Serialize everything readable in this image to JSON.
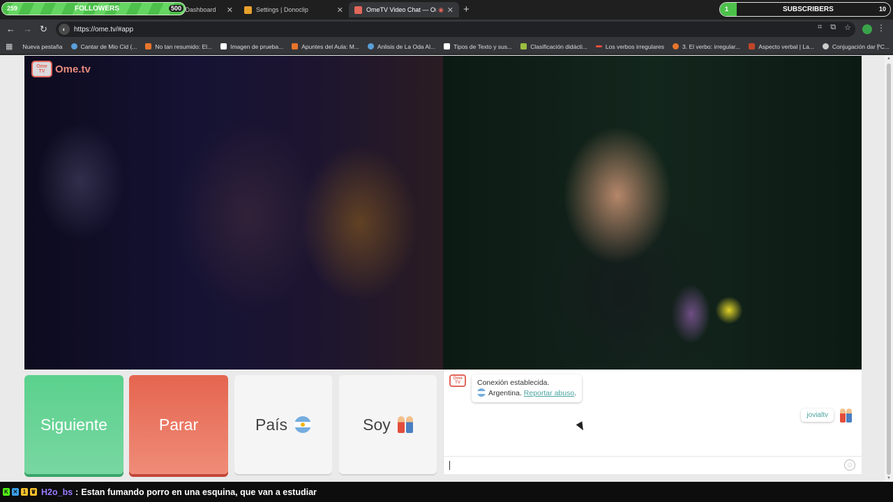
{
  "overlay": {
    "followers": {
      "count": "259",
      "label": "FOLLOWERS",
      "goal": "500"
    },
    "subscribers": {
      "count": "1",
      "label": "SUBSCRIBERS",
      "goal": "10"
    }
  },
  "tabs": [
    {
      "title": "Stream - Kick Dashboard",
      "active": false,
      "color": "#53fc18"
    },
    {
      "title": "Settings | Donoclip",
      "active": false,
      "color": "#e8a02c"
    },
    {
      "title": "OmeTV Video Chat — Ome",
      "active": true,
      "color": "#e2665a"
    }
  ],
  "address": {
    "url": "https://ome.tv/#app"
  },
  "bookmarks": [
    {
      "label": "Nueva pestaña",
      "color": "#555"
    },
    {
      "label": "Cantar de Mio Cid (...",
      "color": "#5aa0d8"
    },
    {
      "label": "No tan resumido: El...",
      "color": "#e8742c"
    },
    {
      "label": "Imagen de prueba...",
      "color": "#ffffff"
    },
    {
      "label": "Apuntes del Aula: M...",
      "color": "#e8742c"
    },
    {
      "label": "Anlisis de La Oda Al...",
      "color": "#5aa0d8"
    },
    {
      "label": "Tipos de Texto y sus...",
      "color": "#ffffff"
    },
    {
      "label": "Clasificación didácti...",
      "color": "#9bbf3f"
    },
    {
      "label": "Los verbos irregulares",
      "color": "#e24d3b"
    },
    {
      "label": "3. El verbo: irregular...",
      "color": "#e8742c"
    },
    {
      "label": "Aspecto verbal | La...",
      "color": "#c0452a"
    },
    {
      "label": "Conjugación dar | C...",
      "color": "#cccccc"
    }
  ],
  "app": {
    "logo": "Ome.tv",
    "logo_badge": "Ome TV",
    "buttons": {
      "next": "Siguiente",
      "stop": "Parar",
      "country": "País",
      "gender": "Soy"
    },
    "chat": {
      "system_line1": "Conexión establecida.",
      "country": "Argentina.",
      "report_link": "Reportar abuso",
      "report_suffix": ".",
      "username": "jovialtv"
    }
  },
  "stream_chat": {
    "username": "H2o_bs",
    "message": "Estan fumando porro en una esquina, que van a estudiar"
  },
  "colors": {
    "next": "#5bd18d",
    "stop": "#e5654f",
    "accent": "#4aa5a0",
    "username": "#9b7bff"
  }
}
